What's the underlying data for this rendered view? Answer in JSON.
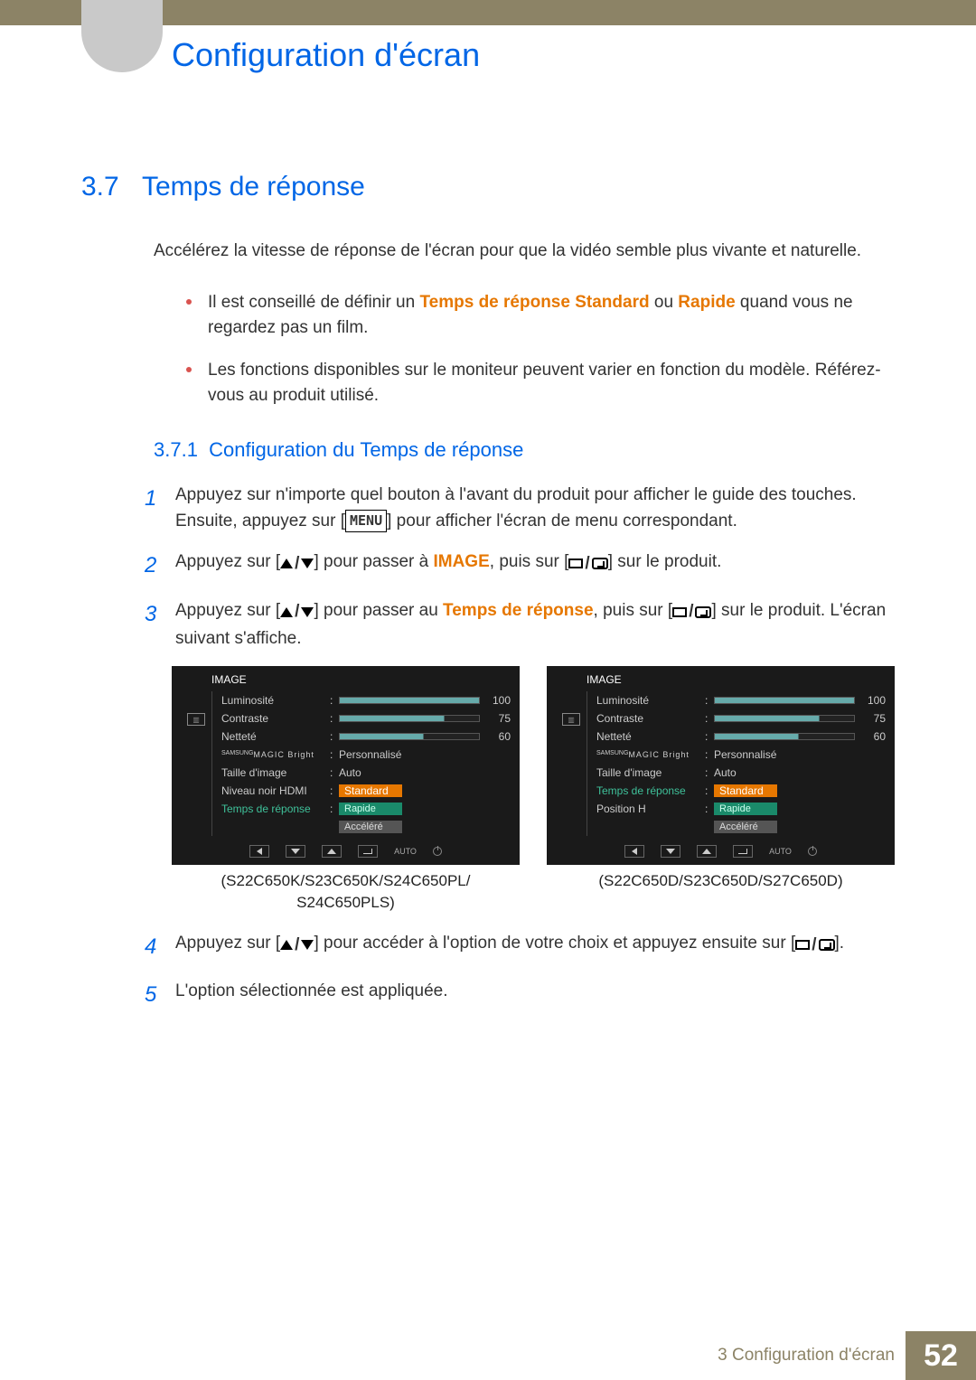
{
  "chapter_title": "Configuration d'écran",
  "section": {
    "num": "3.7",
    "title": "Temps de réponse"
  },
  "intro": "Accélérez la vitesse de réponse de l'écran pour que la vidéo semble plus vivante et naturelle.",
  "bullets": {
    "b1_pre": "Il est conseillé de définir un ",
    "b1_hl1": "Temps de réponse",
    "b1_mid1": " ",
    "b1_hl2": "Standard",
    "b1_mid2": " ou ",
    "b1_hl3": "Rapide",
    "b1_post": " quand vous ne regardez pas un film.",
    "b2": "Les fonctions disponibles sur le moniteur peuvent varier en fonction du modèle. Référez-vous au produit utilisé."
  },
  "subsection": {
    "num": "3.7.1",
    "title": "Configuration du Temps de réponse"
  },
  "steps": {
    "s1_a": "Appuyez sur n'importe quel bouton à l'avant du produit pour afficher le guide des touches. Ensuite, appuyez sur [",
    "s1_menu": "MENU",
    "s1_b": "] pour afficher l'écran de menu correspondant.",
    "s2_a": "Appuyez sur [",
    "s2_b": "] pour passer à ",
    "s2_hl": "IMAGE",
    "s2_c": ", puis sur [",
    "s2_d": "] sur le produit.",
    "s3_a": "Appuyez sur [",
    "s3_b": "] pour passer au ",
    "s3_hl": "Temps de réponse",
    "s3_c": ", puis sur [",
    "s3_d": "] sur le produit. L'écran suivant s'affiche.",
    "s4_a": "Appuyez sur [",
    "s4_b": "] pour accéder à l'option de votre choix et appuyez ensuite sur [",
    "s4_c": "].",
    "s5": "L'option sélectionnée est appliquée."
  },
  "osd": {
    "title": "IMAGE",
    "luminosite": "Luminosité",
    "contraste": "Contraste",
    "nettete": "Netteté",
    "magic": "MAGIC",
    "magic_sup": "SAMSUNG",
    "magic_suffix": " Bright",
    "taille": "Taille d'image",
    "hdmi": "Niveau noir HDMI",
    "temps": "Temps de réponse",
    "posh": "Position H",
    "val100": "100",
    "val75": "75",
    "val60": "60",
    "personnalise": "Personnalisé",
    "auto": "Auto",
    "standard": "Standard",
    "rapide": "Rapide",
    "accelere": "Accéléré",
    "nav_auto": "AUTO"
  },
  "captions": {
    "left": "(S22C650K/S23C650K/S24C650PL/\nS24C650PLS)",
    "right": "(S22C650D/S23C650D/S27C650D)"
  },
  "footer": {
    "text": "3 Configuration d'écran",
    "page": "52"
  }
}
